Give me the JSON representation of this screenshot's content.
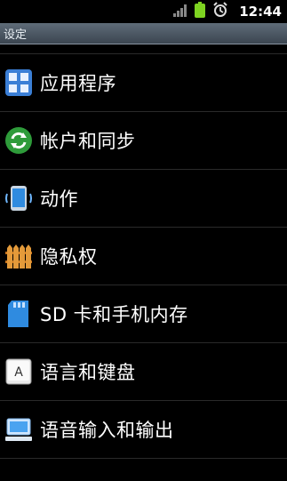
{
  "status_bar": {
    "time": "12:44",
    "signal_icon": "signal-icon",
    "battery_icon": "battery-icon",
    "alarm_icon": "alarm-icon"
  },
  "title_bar": {
    "title": "设定"
  },
  "settings": {
    "items": [
      {
        "label": "应用程序",
        "icon": "apps-icon"
      },
      {
        "label": "帐户和同步",
        "icon": "sync-icon"
      },
      {
        "label": "动作",
        "icon": "phone-motion-icon"
      },
      {
        "label": "隐私权",
        "icon": "fence-icon"
      },
      {
        "label": "SD 卡和手机内存",
        "icon": "sd-card-icon"
      },
      {
        "label": "语言和键盘",
        "icon": "keyboard-icon"
      },
      {
        "label": "语音输入和输出",
        "icon": "voice-io-icon"
      }
    ]
  },
  "colors": {
    "background": "#000000",
    "title_bar": "#4a5561",
    "divider": "#2a2a2a",
    "battery": "#7ed321"
  }
}
